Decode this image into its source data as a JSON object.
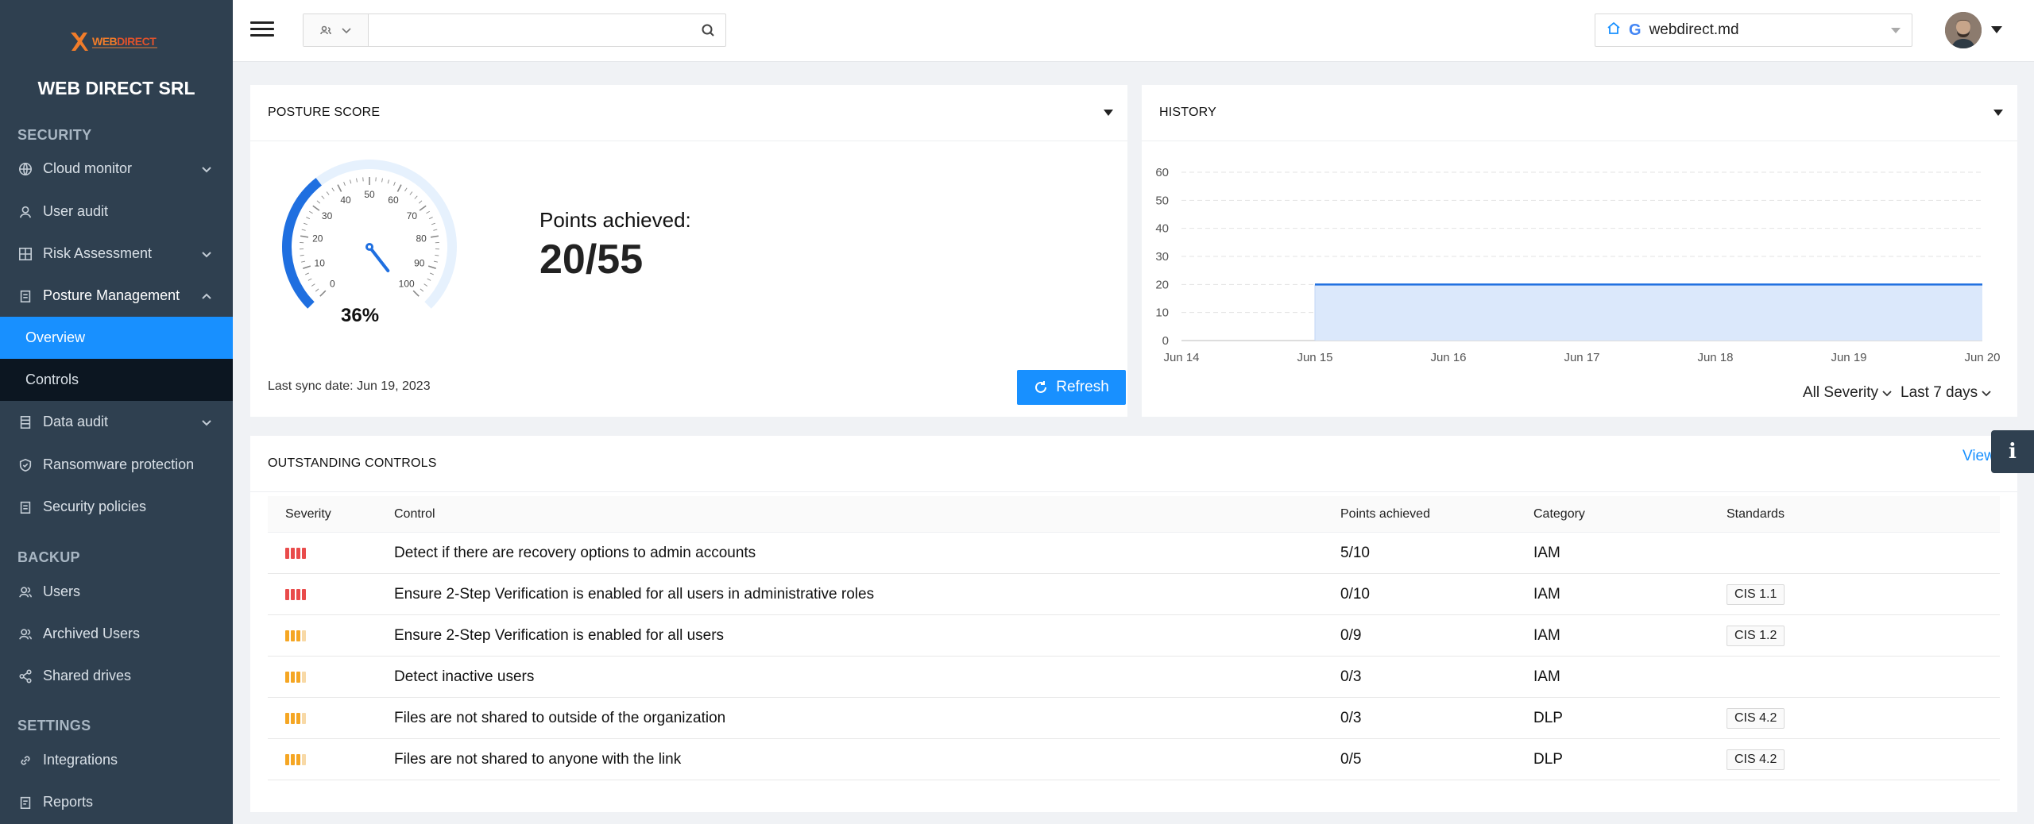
{
  "brand": {
    "logo_text_a": "WEB",
    "logo_text_b": "DIRECT",
    "company": "WEB DIRECT SRL"
  },
  "sidebar": {
    "sections": [
      {
        "title": "SECURITY"
      },
      {
        "title": "BACKUP"
      },
      {
        "title": "SETTINGS"
      }
    ],
    "items": [
      {
        "label": "Cloud monitor",
        "icon": "globe-icon",
        "expandable": true
      },
      {
        "label": "User audit",
        "icon": "user-icon"
      },
      {
        "label": "Risk Assessment",
        "icon": "grid-icon",
        "expandable": true
      },
      {
        "label": "Posture Management",
        "icon": "clipboard-icon",
        "expanded": true
      },
      {
        "label": "Overview",
        "selected": true
      },
      {
        "label": "Controls"
      },
      {
        "label": "Data audit",
        "icon": "database-icon",
        "expandable": true
      },
      {
        "label": "Ransomware protection",
        "icon": "shield-icon"
      },
      {
        "label": "Security policies",
        "icon": "clipboard-icon"
      },
      {
        "label": "Users",
        "icon": "users-icon"
      },
      {
        "label": "Archived Users",
        "icon": "users-icon"
      },
      {
        "label": "Shared drives",
        "icon": "share-icon"
      },
      {
        "label": "Integrations",
        "icon": "link-icon"
      },
      {
        "label": "Reports",
        "icon": "report-icon"
      }
    ]
  },
  "topbar": {
    "search_placeholder": "",
    "domain": "webdirect.md"
  },
  "posture": {
    "title": "POSTURE SCORE",
    "percent_label": "36%",
    "percent": 36,
    "gauge_ticks": [
      "0",
      "10",
      "20",
      "30",
      "40",
      "50",
      "60",
      "70",
      "80",
      "90",
      "100"
    ],
    "points_label": "Points achieved:",
    "points_value": "20/55",
    "sync_label": "Last sync date: Jun 19, 2023",
    "refresh_label": "Refresh"
  },
  "history": {
    "title": "HISTORY",
    "severity_filter": "All Severity",
    "range_filter": "Last 7 days"
  },
  "chart_data": {
    "type": "area",
    "x": [
      "Jun 14",
      "Jun 15",
      "Jun 16",
      "Jun 17",
      "Jun 18",
      "Jun 19",
      "Jun 20"
    ],
    "series": [
      {
        "values": [
          null,
          20,
          20,
          20,
          20,
          20,
          20
        ]
      }
    ],
    "yticks": [
      "0",
      "10",
      "20",
      "30",
      "40",
      "50",
      "60"
    ],
    "ylim": [
      0,
      60
    ],
    "grid": true,
    "color": "#1f6fe0"
  },
  "controls": {
    "title": "OUTSTANDING CONTROLS",
    "view_all": "View All",
    "columns": [
      "Severity",
      "Control",
      "Points achieved",
      "Category",
      "Standards"
    ],
    "rows": [
      {
        "severity": "critical",
        "control": "Detect if there are recovery options to admin accounts",
        "points": "5/10",
        "category": "IAM",
        "standard": ""
      },
      {
        "severity": "critical",
        "control": "Ensure 2-Step Verification is enabled for all users in administrative roles",
        "points": "0/10",
        "category": "IAM",
        "standard": "CIS 1.1"
      },
      {
        "severity": "high",
        "control": "Ensure 2-Step Verification is enabled for all users",
        "points": "0/9",
        "category": "IAM",
        "standard": "CIS 1.2"
      },
      {
        "severity": "high",
        "control": "Detect inactive users",
        "points": "0/3",
        "category": "IAM",
        "standard": ""
      },
      {
        "severity": "high",
        "control": "Files are not shared to outside of the organization",
        "points": "0/3",
        "category": "DLP",
        "standard": "CIS 4.2"
      },
      {
        "severity": "high",
        "control": "Files are not shared to anyone with the link",
        "points": "0/5",
        "category": "DLP",
        "standard": "CIS 4.2"
      }
    ],
    "severity_colors": {
      "critical": "#e94b4b",
      "high": "#f5a623",
      "dim": "#f8d9a6"
    }
  }
}
